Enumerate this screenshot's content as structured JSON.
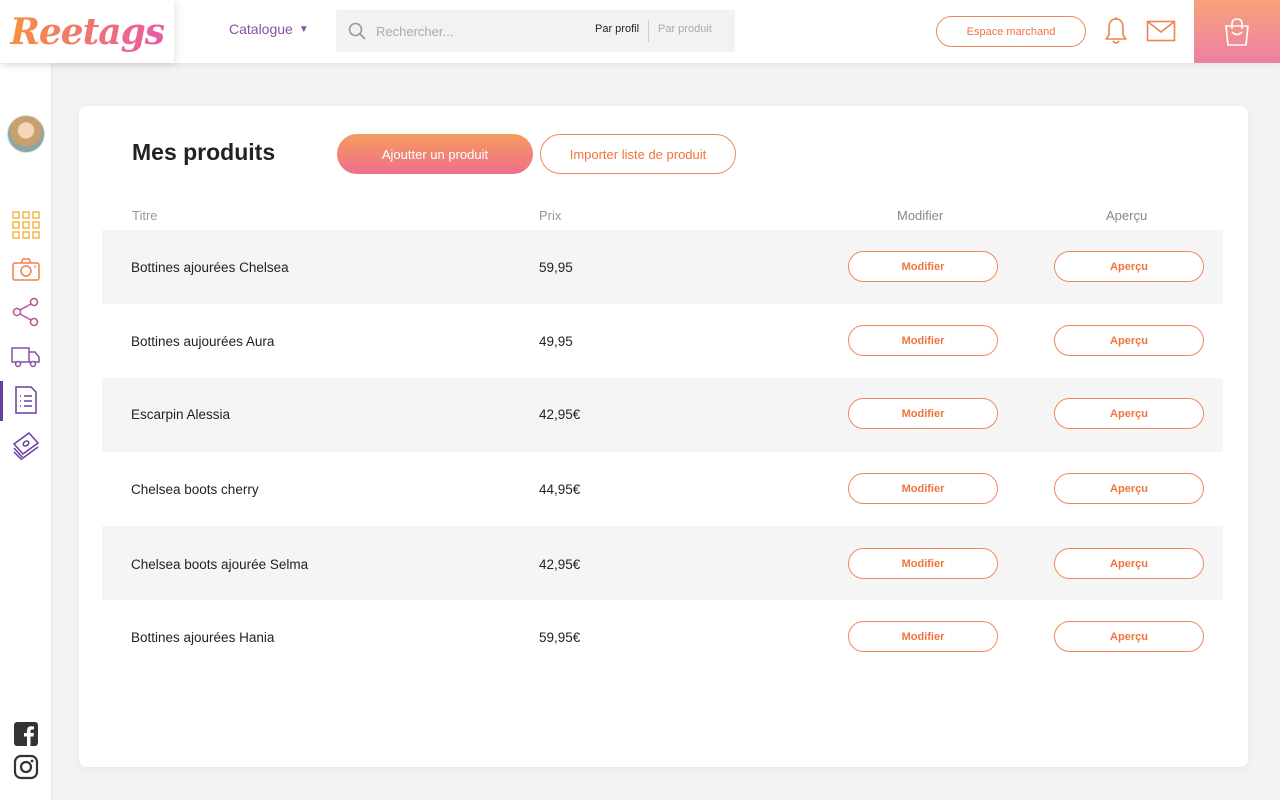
{
  "header": {
    "logo_text": "Reetags",
    "catalogue_label": "Catalogue",
    "search_placeholder": "Rechercher...",
    "search_mode_profile": "Par profil",
    "search_mode_product": "Par produit",
    "merchant_button": "Espace marchand",
    "icons": [
      "bell-icon",
      "mail-icon",
      "shopping-bag-icon"
    ]
  },
  "sidebar": {
    "items": [
      {
        "icon": "grid-icon"
      },
      {
        "icon": "camera-icon"
      },
      {
        "icon": "share-icon"
      },
      {
        "icon": "delivery-truck-icon"
      },
      {
        "icon": "document-list-icon",
        "active": true
      },
      {
        "icon": "money-stack-icon"
      }
    ],
    "social": [
      "facebook-icon",
      "instagram-icon"
    ]
  },
  "main": {
    "title": "Mes produits",
    "add_button": "Ajoutter un produit",
    "import_button": "Importer liste de produit",
    "columns": {
      "title": "Titre",
      "price": "Prix",
      "edit": "Modifier",
      "preview": "Aperçu"
    },
    "products": [
      {
        "title": "Bottines ajourées Chelsea",
        "price": "59,95",
        "edit": "Modifier",
        "preview": "Aperçu"
      },
      {
        "title": "Bottines aujourées Aura",
        "price": "49,95",
        "edit": "Modifier",
        "preview": "Aperçu"
      },
      {
        "title": "Escarpin Alessia",
        "price": "42,95€",
        "edit": "Modifier",
        "preview": "Aperçu"
      },
      {
        "title": "Chelsea boots cherry",
        "price": "44,95€",
        "edit": "Modifier",
        "preview": "Aperçu"
      },
      {
        "title": "Chelsea boots ajourée Selma",
        "price": "42,95€",
        "edit": "Modifier",
        "preview": "Aperçu"
      },
      {
        "title": "Bottines ajourées Hania",
        "price": "59,95€",
        "edit": "Modifier",
        "preview": "Aperçu"
      }
    ]
  },
  "colors": {
    "accent_orange": "#f0743f",
    "accent_pink": "#ee6f8c",
    "accent_purple": "#8a4fa8"
  }
}
